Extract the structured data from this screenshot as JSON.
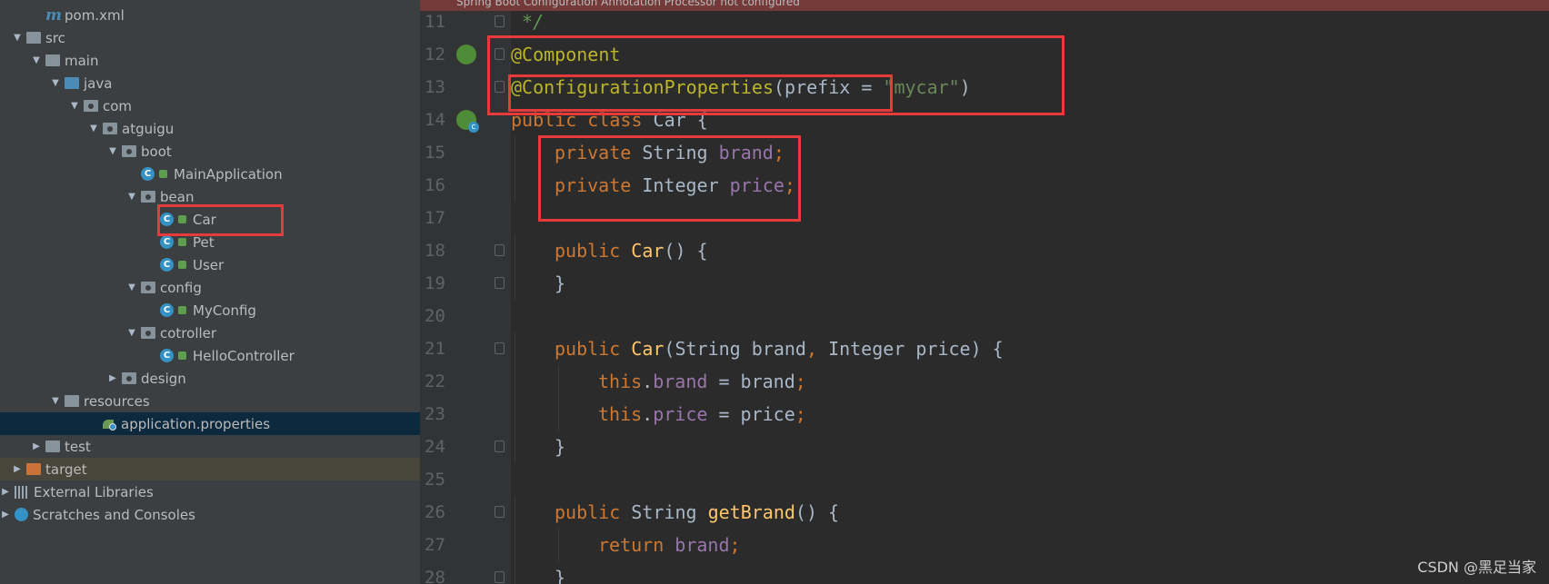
{
  "tree": {
    "items": [
      {
        "label": "pom.xml",
        "indent": 2,
        "arrow": "none",
        "icon": "maven-icon"
      },
      {
        "label": "src",
        "indent": 1,
        "arrow": "down",
        "icon": "folder-icon"
      },
      {
        "label": "main",
        "indent": 2,
        "arrow": "down",
        "icon": "folder-icon"
      },
      {
        "label": "java",
        "indent": 3,
        "arrow": "down",
        "icon": "source-folder-icon"
      },
      {
        "label": "com",
        "indent": 4,
        "arrow": "down",
        "icon": "package-icon"
      },
      {
        "label": "atguigu",
        "indent": 5,
        "arrow": "down",
        "icon": "package-icon"
      },
      {
        "label": "boot",
        "indent": 6,
        "arrow": "down",
        "icon": "package-icon"
      },
      {
        "label": "MainApplication",
        "indent": 7,
        "arrow": "none",
        "icon": "spring-class-icon"
      },
      {
        "label": "bean",
        "indent": 7,
        "arrow": "down",
        "icon": "package-icon"
      },
      {
        "label": "Car",
        "indent": 8,
        "arrow": "none",
        "icon": "class-icon"
      },
      {
        "label": "Pet",
        "indent": 8,
        "arrow": "none",
        "icon": "class-icon"
      },
      {
        "label": "User",
        "indent": 8,
        "arrow": "none",
        "icon": "class-icon"
      },
      {
        "label": "config",
        "indent": 7,
        "arrow": "down",
        "icon": "package-icon"
      },
      {
        "label": "MyConfig",
        "indent": 8,
        "arrow": "none",
        "icon": "class-icon"
      },
      {
        "label": "cotroller",
        "indent": 7,
        "arrow": "down",
        "icon": "package-icon"
      },
      {
        "label": "HelloController",
        "indent": 8,
        "arrow": "none",
        "icon": "class-icon"
      },
      {
        "label": "design",
        "indent": 6,
        "arrow": "right",
        "icon": "package-icon"
      },
      {
        "label": "resources",
        "indent": 3,
        "arrow": "down",
        "icon": "resources-folder-icon"
      },
      {
        "label": "application.properties",
        "indent": 5,
        "arrow": "none",
        "icon": "spring-properties-icon",
        "state": "selected"
      },
      {
        "label": "test",
        "indent": 2,
        "arrow": "right",
        "icon": "folder-icon"
      },
      {
        "label": "target",
        "indent": 1,
        "arrow": "right",
        "icon": "excluded-folder-icon",
        "state": "excluded"
      },
      {
        "label": "External Libraries",
        "indent": 0,
        "arrow": "right",
        "icon": "libraries-icon"
      },
      {
        "label": "Scratches and Consoles",
        "indent": 0,
        "arrow": "right",
        "icon": "scratches-icon"
      }
    ]
  },
  "editor": {
    "banner_text": "Spring Boot Configuration Annotation Processor not configured",
    "lines": [
      {
        "n": "11",
        "indent": 0,
        "tokens": [
          {
            "t": " */",
            "c": "cmt"
          }
        ],
        "fold": true
      },
      {
        "n": "12",
        "indent": 0,
        "tokens": [
          {
            "t": "@Component",
            "c": "ann"
          }
        ],
        "fold": true,
        "gutter": "bean-icon"
      },
      {
        "n": "13",
        "indent": 0,
        "tokens": [
          {
            "t": "@ConfigurationProperties",
            "c": "ann"
          },
          {
            "t": "(prefix = ",
            "c": "pl"
          },
          {
            "t": "\"mycar\"",
            "c": "str"
          },
          {
            "t": ")",
            "c": "pl"
          }
        ],
        "fold": true
      },
      {
        "n": "14",
        "indent": 0,
        "tokens": [
          {
            "t": "public class ",
            "c": "kw"
          },
          {
            "t": "Car {",
            "c": "pl"
          }
        ],
        "gutter": "bean-class-icon"
      },
      {
        "n": "15",
        "indent": 1,
        "tokens": [
          {
            "t": "private ",
            "c": "kw"
          },
          {
            "t": "String ",
            "c": "pl"
          },
          {
            "t": "brand",
            "c": "fld"
          },
          {
            "t": ";",
            "c": "kw"
          }
        ]
      },
      {
        "n": "16",
        "indent": 1,
        "tokens": [
          {
            "t": "private ",
            "c": "kw"
          },
          {
            "t": "Integer ",
            "c": "pl"
          },
          {
            "t": "price",
            "c": "fld"
          },
          {
            "t": ";",
            "c": "kw"
          }
        ]
      },
      {
        "n": "17",
        "indent": 0,
        "tokens": []
      },
      {
        "n": "18",
        "indent": 1,
        "tokens": [
          {
            "t": "public ",
            "c": "kw"
          },
          {
            "t": "Car",
            "c": "fn"
          },
          {
            "t": "() {",
            "c": "pl"
          }
        ],
        "fold": true
      },
      {
        "n": "19",
        "indent": 1,
        "tokens": [
          {
            "t": "}",
            "c": "pl"
          }
        ],
        "fold": true
      },
      {
        "n": "20",
        "indent": 0,
        "tokens": []
      },
      {
        "n": "21",
        "indent": 1,
        "tokens": [
          {
            "t": "public ",
            "c": "kw"
          },
          {
            "t": "Car",
            "c": "fn"
          },
          {
            "t": "(String brand",
            "c": "pl"
          },
          {
            "t": ", ",
            "c": "kw"
          },
          {
            "t": "Integer price) {",
            "c": "pl"
          }
        ],
        "fold": true
      },
      {
        "n": "22",
        "indent": 2,
        "tokens": [
          {
            "t": "this",
            "c": "kw"
          },
          {
            "t": ".",
            "c": "pl"
          },
          {
            "t": "brand",
            "c": "fld"
          },
          {
            "t": " = brand",
            "c": "pl"
          },
          {
            "t": ";",
            "c": "kw"
          }
        ]
      },
      {
        "n": "23",
        "indent": 2,
        "tokens": [
          {
            "t": "this",
            "c": "kw"
          },
          {
            "t": ".",
            "c": "pl"
          },
          {
            "t": "price",
            "c": "fld"
          },
          {
            "t": " = price",
            "c": "pl"
          },
          {
            "t": ";",
            "c": "kw"
          }
        ]
      },
      {
        "n": "24",
        "indent": 1,
        "tokens": [
          {
            "t": "}",
            "c": "pl"
          }
        ],
        "fold": true
      },
      {
        "n": "25",
        "indent": 0,
        "tokens": []
      },
      {
        "n": "26",
        "indent": 1,
        "tokens": [
          {
            "t": "public ",
            "c": "kw"
          },
          {
            "t": "String ",
            "c": "pl"
          },
          {
            "t": "getBrand",
            "c": "fn"
          },
          {
            "t": "() {",
            "c": "pl"
          }
        ],
        "fold": true
      },
      {
        "n": "27",
        "indent": 2,
        "tokens": [
          {
            "t": "return ",
            "c": "kw"
          },
          {
            "t": "brand",
            "c": "fld"
          },
          {
            "t": ";",
            "c": "kw"
          }
        ]
      },
      {
        "n": "28",
        "indent": 1,
        "tokens": [
          {
            "t": "}",
            "c": "pl"
          }
        ],
        "fold": true
      }
    ]
  },
  "watermark": "CSDN @黑足当家",
  "colors": {
    "tree_bg": "#3c3f41",
    "editor_bg": "#2b2b2b",
    "keyword": "#cc7832",
    "annotation": "#bbb529",
    "field": "#9876aa",
    "method": "#ffc66d",
    "string": "#6a8759",
    "highlight_box": "#e83a3a",
    "selection": "#0d293e"
  }
}
